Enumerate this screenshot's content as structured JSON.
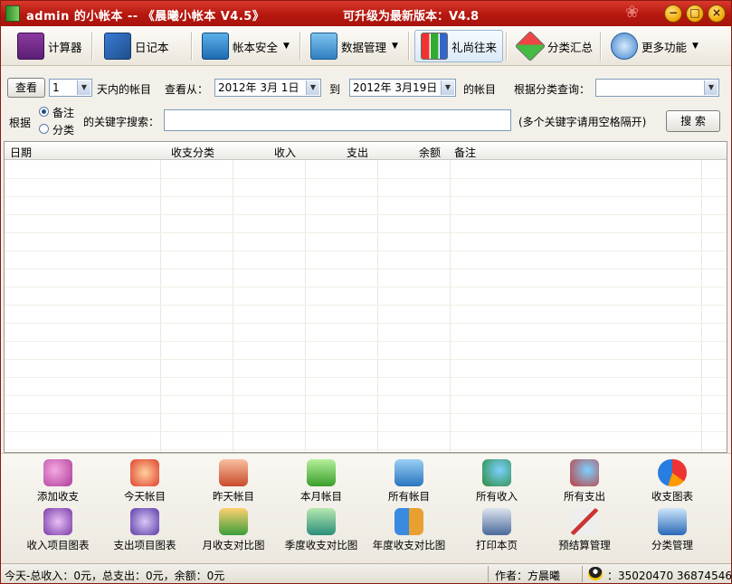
{
  "window": {
    "title": "admin 的小帐本 -- 《晨曦小帐本 V4.5》",
    "upgrade_notice": "可升级为最新版本：V4.8",
    "minimize": "−",
    "maximize": "□",
    "close": "×"
  },
  "toolbar": {
    "items": [
      {
        "label": "计算器",
        "icon": "calculator-icon"
      },
      {
        "label": "日记本",
        "icon": "diary-icon"
      },
      {
        "label": "帐本安全",
        "icon": "security-icon",
        "dropdown": true
      },
      {
        "label": "数据管理",
        "icon": "data-icon",
        "dropdown": true
      },
      {
        "label": "礼尚往来",
        "icon": "gift-chart-icon",
        "active": true
      },
      {
        "label": "分类汇总",
        "icon": "category-icon"
      },
      {
        "label": "更多功能",
        "icon": "more-icon",
        "dropdown": true
      }
    ],
    "caret": "▼"
  },
  "filter": {
    "view_button": "查看",
    "days_value": "1",
    "days_suffix": "天内的帐目",
    "from_label": "查看从：",
    "from_date": "2012年 3月 1日",
    "to_label": "到",
    "to_date": "2012年 3月19日",
    "ledger_suffix": "的帐目",
    "category_label": "根据分类查询：",
    "category_value": "",
    "by_label": "根据",
    "radio_note": "备注",
    "radio_category": "分类",
    "keyword_label": "的关键字搜索：",
    "keyword_value": "",
    "hint": "(多个关键字请用空格隔开)",
    "search_button": "搜 索"
  },
  "table": {
    "columns": [
      "日期",
      "收支分类",
      "收入",
      "支出",
      "余额",
      "备注"
    ]
  },
  "actions": {
    "row1": [
      {
        "label": "添加收支",
        "icon": "add-entry-icon"
      },
      {
        "label": "今天帐目",
        "icon": "today-icon"
      },
      {
        "label": "昨天帐目",
        "icon": "yesterday-icon"
      },
      {
        "label": "本月帐目",
        "icon": "month-icon"
      },
      {
        "label": "所有帐目",
        "icon": "all-entries-icon"
      },
      {
        "label": "所有收入",
        "icon": "all-income-icon"
      },
      {
        "label": "所有支出",
        "icon": "all-expense-icon"
      },
      {
        "label": "收支图表",
        "icon": "pie-chart-icon"
      }
    ],
    "row2": [
      {
        "label": "收入项目图表",
        "icon": "income-chart-icon"
      },
      {
        "label": "支出项目图表",
        "icon": "expense-chart-icon"
      },
      {
        "label": "月收支对比图",
        "icon": "monthly-compare-icon"
      },
      {
        "label": "季度收支对比图",
        "icon": "quarterly-compare-icon"
      },
      {
        "label": "年度收支对比图",
        "icon": "yearly-compare-icon"
      },
      {
        "label": "打印本页",
        "icon": "print-icon"
      },
      {
        "label": "预结算管理",
        "icon": "budget-icon"
      },
      {
        "label": "分类管理",
        "icon": "category-manage-icon"
      }
    ]
  },
  "status": {
    "summary": "今天-总收入：0元，总支出：0元，余额：0元",
    "author": "作者：方晨曦",
    "qq": "：35020470   36874546"
  },
  "colors": {
    "titlebar": "#b5170f",
    "accent_blue": "#1e4f8a"
  }
}
